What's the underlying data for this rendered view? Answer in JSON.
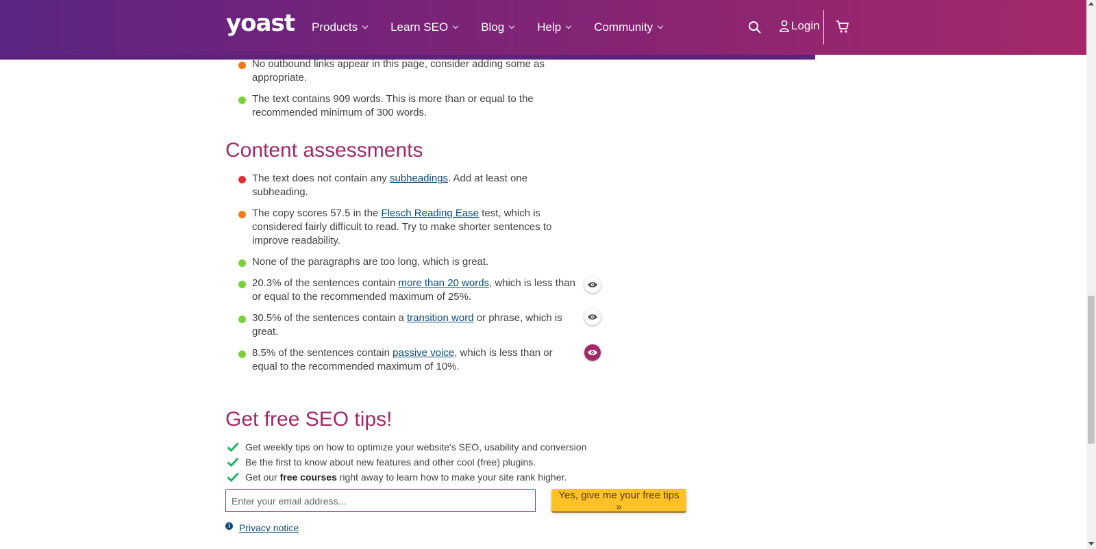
{
  "header": {
    "logo": "yoast",
    "nav": [
      {
        "label": "Products"
      },
      {
        "label": "Learn SEO"
      },
      {
        "label": "Blog"
      },
      {
        "label": "Help"
      },
      {
        "label": "Community"
      }
    ],
    "search_icon": "search-icon",
    "login_label": "Login",
    "cart_icon": "cart-icon",
    "colors": {
      "gradient_start": "#5b2483",
      "gradient_end": "#a4286a"
    }
  },
  "seo_assessments_tail": [
    {
      "status": "orange",
      "text": "No outbound links appear in this page, consider adding some as appropriate."
    },
    {
      "status": "green",
      "text": "The text contains 909 words. This is more than or equal to the recommended minimum of 300 words."
    }
  ],
  "content_assessments": {
    "title": "Content assessments",
    "items": [
      {
        "status": "red",
        "before": "The text does not contain any ",
        "link": "subheadings",
        "after": ". Add at least one subheading."
      },
      {
        "status": "orange",
        "before": "The copy scores 57.5 in the ",
        "link": "Flesch Reading Ease",
        "after": " test, which is considered fairly difficult to read. Try to make shorter sentences to improve readability."
      },
      {
        "status": "green",
        "before": "None of the paragraphs are too long, which is great.",
        "link": "",
        "after": ""
      },
      {
        "status": "green",
        "before": "20.3% of the sentences contain ",
        "link": "more than 20 words",
        "after": ", which is less than or equal to the recommended maximum of 25%.",
        "eye": "inactive"
      },
      {
        "status": "green",
        "before": "30.5% of the sentences contain a ",
        "link": "transition word",
        "after": " or phrase, which is great.",
        "eye": "inactive"
      },
      {
        "status": "green",
        "before": "8.5% of the sentences contain ",
        "link": "passive voice",
        "after": ", which is less than or equal to the recommended maximum of 10%.",
        "eye": "active"
      }
    ]
  },
  "status_colors": {
    "red": "#dc3232",
    "orange": "#ee7c1b",
    "green": "#7ad03a"
  },
  "newsletter": {
    "title": "Get free SEO tips!",
    "benefits": [
      {
        "before": "Get weekly tips on how to optimize your website's SEO, usability and conversion",
        "bold": "",
        "after": ""
      },
      {
        "before": "Be the first to know about new features and other cool (free) plugins.",
        "bold": "",
        "after": ""
      },
      {
        "before": "Get our ",
        "bold": "free courses",
        "after": " right away to learn how to make your site rank higher."
      }
    ],
    "email_placeholder": "Enter your email address...",
    "submit_label": "Yes, give me your free tips »",
    "privacy_label": "Privacy notice",
    "check_color": "#1ab65f",
    "button_color": "#fec228"
  }
}
